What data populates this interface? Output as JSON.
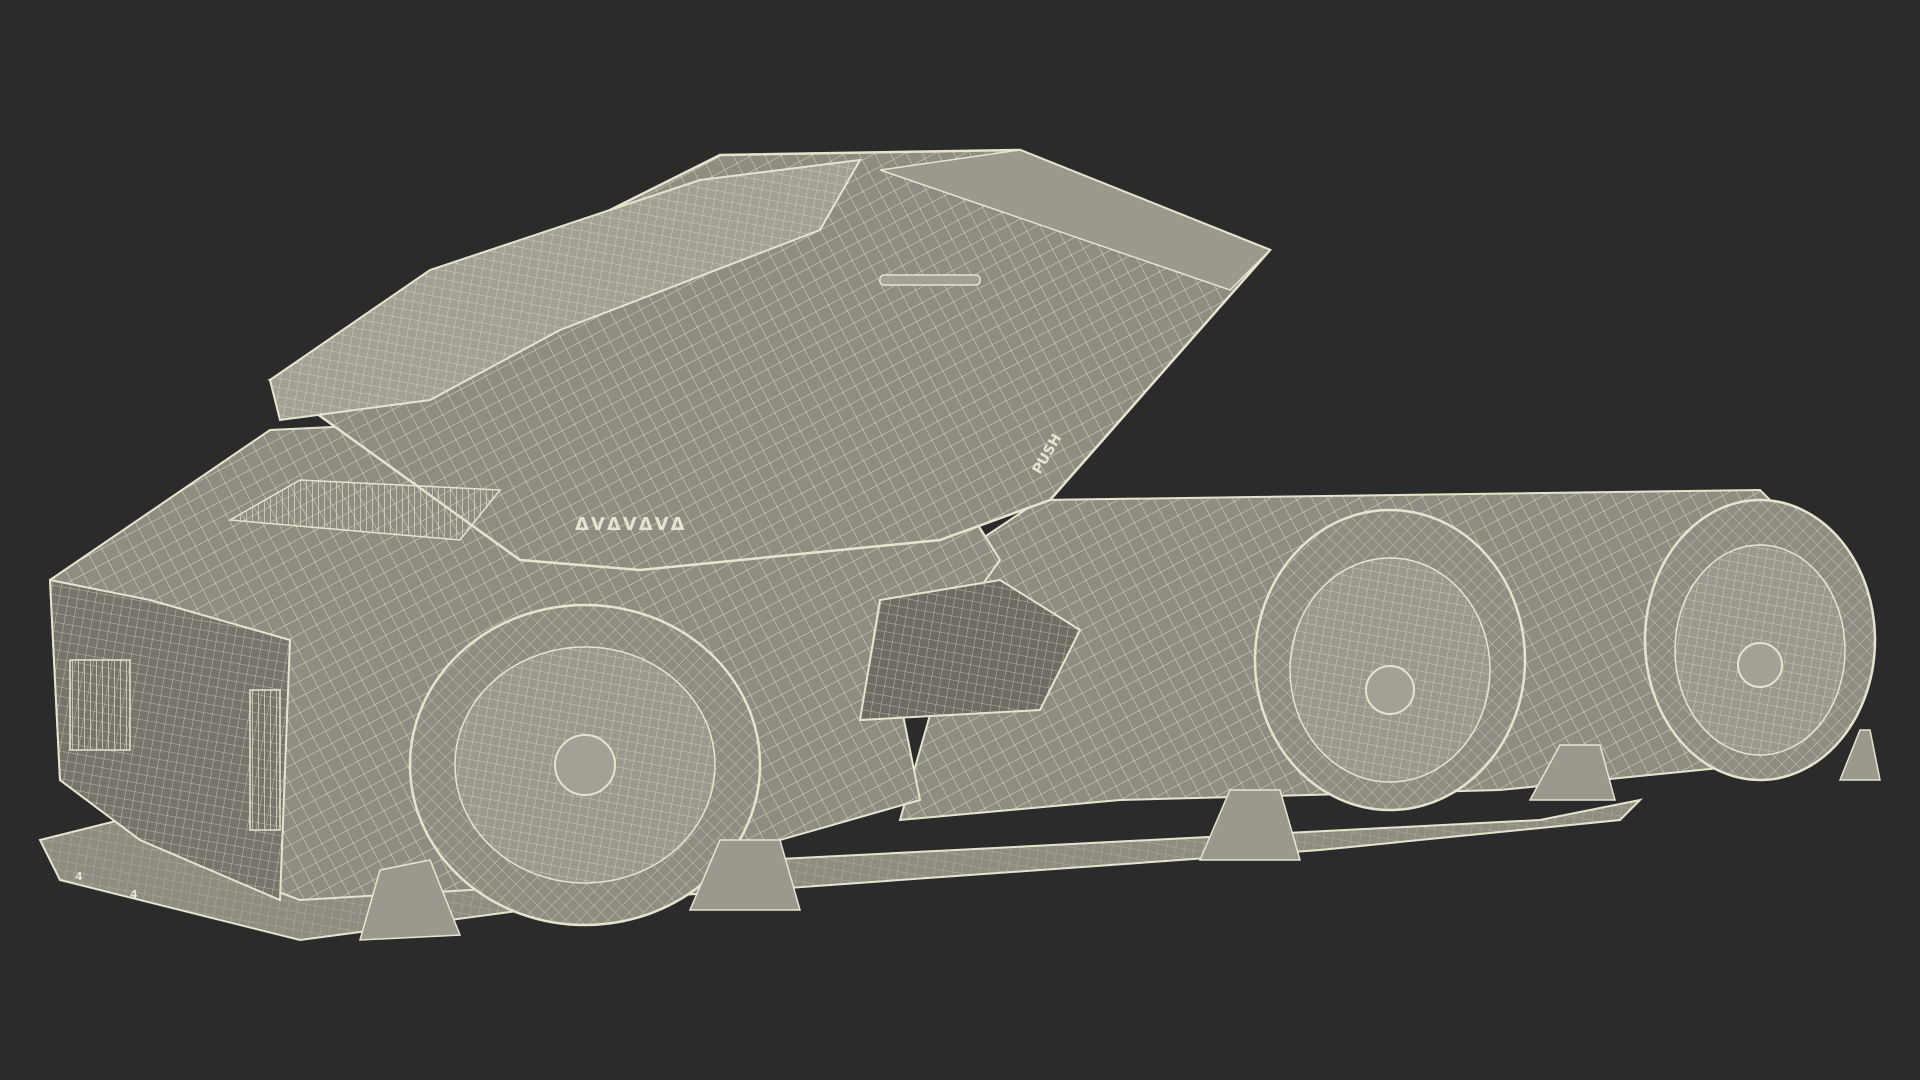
{
  "scene": {
    "background_color": "#2b2b2b",
    "model_fill": "#8f8d82",
    "model_fill_dark": "#6f6d63",
    "model_fill_light": "#a3a196",
    "wire_color": "#e6e4cf",
    "subject": "wireframe-render-of-six-wheeled-futuristic-vehicle"
  },
  "decals": {
    "logo_glyphs": "ΔVΔVΔVΔ",
    "push_label": "PUSH",
    "marker_a": "4",
    "marker_b": "4"
  }
}
